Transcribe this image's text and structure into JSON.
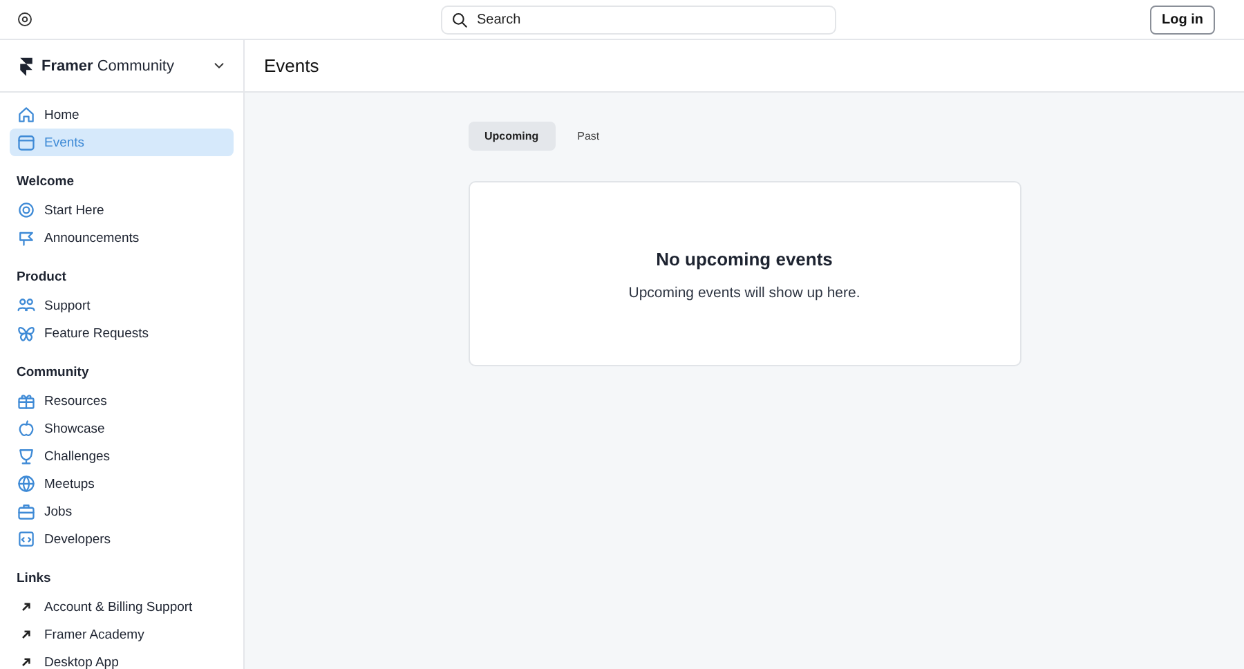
{
  "search": {
    "placeholder": "Search"
  },
  "login_button": "Log in",
  "brand": {
    "name_bold": "Framer",
    "name_rest": "Community"
  },
  "page_title": "Events",
  "sidebar": {
    "sections": [
      {
        "items": [
          {
            "label": "Home",
            "kind": "page",
            "selected": false
          },
          {
            "label": "Events",
            "kind": "page",
            "selected": true
          }
        ]
      },
      {
        "title": "Welcome",
        "items": [
          {
            "label": "Start Here",
            "kind": "page",
            "selected": false
          },
          {
            "label": "Announcements",
            "kind": "page",
            "selected": false
          }
        ]
      },
      {
        "title": "Product",
        "items": [
          {
            "label": "Support",
            "kind": "page",
            "selected": false
          },
          {
            "label": "Feature Requests",
            "kind": "page",
            "selected": false
          }
        ]
      },
      {
        "title": "Community",
        "items": [
          {
            "label": "Resources",
            "kind": "page",
            "selected": false
          },
          {
            "label": "Showcase",
            "kind": "page",
            "selected": false
          },
          {
            "label": "Challenges",
            "kind": "page",
            "selected": false
          },
          {
            "label": "Meetups",
            "kind": "page",
            "selected": false
          },
          {
            "label": "Jobs",
            "kind": "page",
            "selected": false
          },
          {
            "label": "Developers",
            "kind": "page",
            "selected": false
          }
        ]
      },
      {
        "title": "Links",
        "items": [
          {
            "label": "Account & Billing Support",
            "kind": "link",
            "selected": false
          },
          {
            "label": "Framer Academy",
            "kind": "link",
            "selected": false
          },
          {
            "label": "Desktop App",
            "kind": "link",
            "selected": false
          }
        ]
      }
    ]
  },
  "tabs": [
    {
      "label": "Upcoming",
      "selected": true
    },
    {
      "label": "Past",
      "selected": false
    }
  ],
  "empty_state": {
    "title": "No upcoming events",
    "message": "Upcoming events will show up here."
  }
}
